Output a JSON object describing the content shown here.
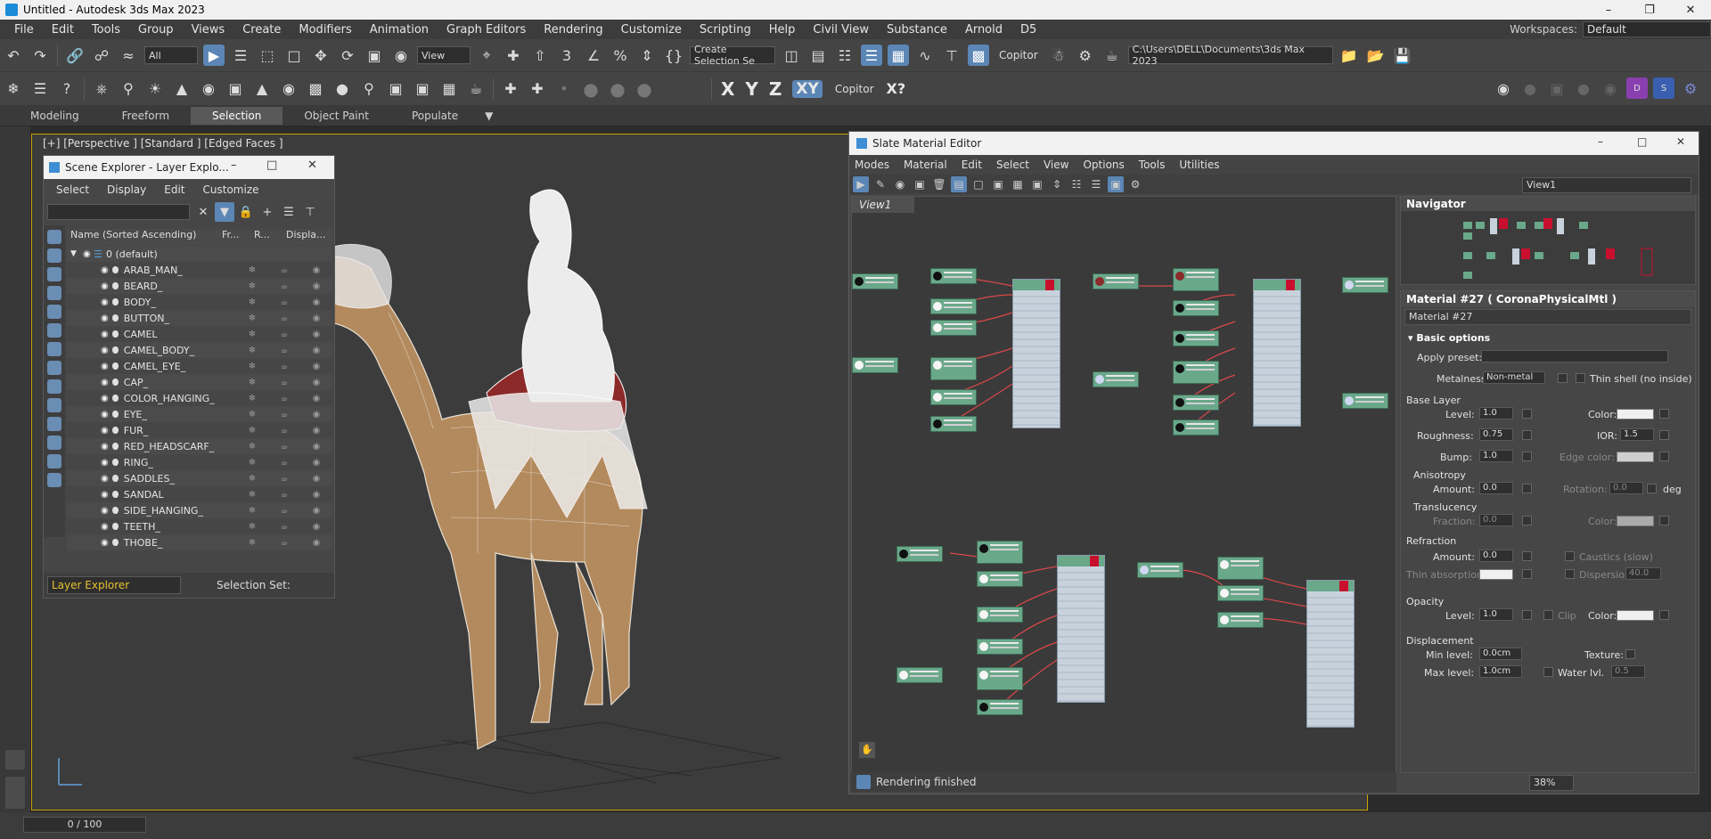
{
  "titlebar": {
    "title": "Untitled - Autodesk 3ds Max 2023"
  },
  "menu": {
    "items": [
      "File",
      "Edit",
      "Tools",
      "Group",
      "Views",
      "Create",
      "Modifiers",
      "Animation",
      "Graph Editors",
      "Rendering",
      "Customize",
      "Scripting",
      "Help",
      "Civil View",
      "Substance",
      "Arnold",
      "D5"
    ]
  },
  "workspace": {
    "label": "Workspaces:",
    "value": "Default"
  },
  "toolbar1": {
    "filter": "All",
    "view": "View",
    "create_selection": "Create Selection Se",
    "copitor": "Copitor",
    "path": "C:\\Users\\DELL\\Documents\\3ds Max 2023"
  },
  "toolbar2": {
    "x": "X",
    "y": "Y",
    "z": "Z",
    "xy": "XY",
    "copitor": "Copitor",
    "xq": "X?"
  },
  "ribbon": {
    "tabs": [
      "Modeling",
      "Freeform",
      "Selection",
      "Object Paint",
      "Populate"
    ],
    "active": "Selection"
  },
  "viewport": {
    "label": "[+] [Perspective ] [Standard ] [Edged Faces ]"
  },
  "scene_explorer": {
    "title": "Scene Explorer - Layer Explo...",
    "menu": [
      "Select",
      "Display",
      "Edit",
      "Customize"
    ],
    "columns": [
      "Name (Sorted Ascending)",
      "Fr...",
      "R...",
      "Displa..."
    ],
    "root": "0 (default)",
    "items": [
      "ARAB_MAN_",
      "BEARD_",
      "BODY_",
      "BUTTON_",
      "CAMEL",
      "CAMEL_BODY_",
      "CAMEL_EYE_",
      "CAP_",
      "COLOR_HANGING_",
      "EYE_",
      "FUR_",
      "RED_HEADSCARF_",
      "RING_",
      "SADDLES_",
      "SANDAL",
      "SIDE_HANGING_",
      "TEETH_",
      "THOBE_"
    ],
    "layer_explorer": "Layer Explorer",
    "selection_set": "Selection Set:"
  },
  "slate": {
    "title": "Slate Material Editor",
    "menu": [
      "Modes",
      "Material",
      "Edit",
      "Select",
      "View",
      "Options",
      "Tools",
      "Utilities"
    ],
    "view_select": "View1",
    "view_tab": "View1",
    "status": "Rendering finished",
    "zoom": "38%",
    "navigator_title": "Navigator"
  },
  "material": {
    "header": "Material #27  ( CoronaPhysicalMtl )",
    "name": "Material #27",
    "basic_options": "Basic options",
    "apply_preset": "Apply preset:",
    "metalness_label": "Metalness:",
    "metalness_value": "Non-metal",
    "thin_shell": "Thin shell (no inside)",
    "base_layer": "Base Layer",
    "level_label": "Level:",
    "level_value": "1.0",
    "color_label": "Color:",
    "roughness_label": "Roughness:",
    "roughness_value": "0.75",
    "ior_label": "IOR:",
    "ior_value": "1.5",
    "bump_label": "Bump:",
    "bump_value": "1.0",
    "edge_color_label": "Edge color:",
    "anisotropy": "Anisotropy",
    "amount_label": "Amount:",
    "aniso_amount": "0.0",
    "rotation_label": "Rotation:",
    "rotation_value": "0.0",
    "deg": "deg",
    "translucency": "Translucency",
    "fraction_label": "Fraction:",
    "fraction_value": "0.0",
    "trans_color_label": "Color:",
    "refraction": "Refraction",
    "refr_amount_label": "Amount:",
    "refr_amount": "0.0",
    "caustics": "Caustics (slow)",
    "thin_absorption": "Thin absorption:",
    "dispersion_label": "Dispersion",
    "dispersion_value": "40.0",
    "opacity": "Opacity",
    "op_level_label": "Level:",
    "op_level": "1.0",
    "clip": "Clip",
    "op_color_label": "Color:",
    "displacement": "Displacement",
    "min_level_label": "Min level:",
    "min_level": "0.0cm",
    "texture_label": "Texture:",
    "max_level_label": "Max level:",
    "max_level": "1.0cm",
    "water_lvl": "Water lvl.",
    "water_value": "0.5"
  },
  "timeline": {
    "frame": "0 / 100"
  }
}
